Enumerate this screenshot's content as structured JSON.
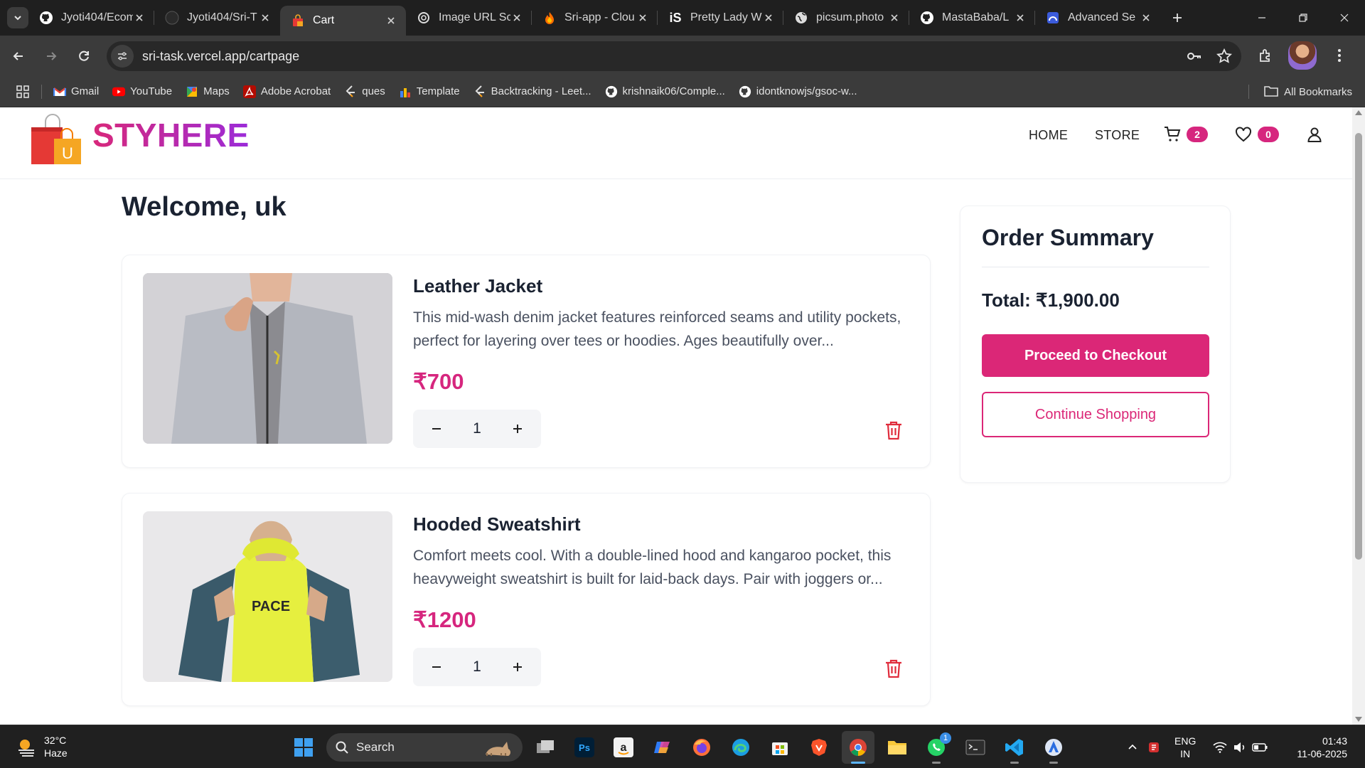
{
  "browser": {
    "tabs": [
      {
        "title": "Jyoti404/Ecom",
        "icon": "github-icon"
      },
      {
        "title": "Jyoti404/Sri-T",
        "icon": "github-icon"
      },
      {
        "title": "Cart",
        "icon": "shopping-bag-icon",
        "active": true
      },
      {
        "title": "Image URL Sc",
        "icon": "openai-icon"
      },
      {
        "title": "Sri-app - Clou",
        "icon": "firebase-icon"
      },
      {
        "title": "Pretty Lady W",
        "icon": "istock-icon"
      },
      {
        "title": "picsum.photo",
        "icon": "globe-icon"
      },
      {
        "title": "MastaBaba/L",
        "icon": "github-icon"
      },
      {
        "title": "Advanced Se",
        "icon": "search-console-icon"
      }
    ],
    "url": "sri-task.vercel.app/cartpage",
    "bookmarks": [
      {
        "label": "Gmail",
        "icon": "gmail-icon"
      },
      {
        "label": "YouTube",
        "icon": "youtube-icon"
      },
      {
        "label": "Maps",
        "icon": "maps-icon"
      },
      {
        "label": "Adobe Acrobat",
        "icon": "acrobat-icon"
      },
      {
        "label": "ques",
        "icon": "leetcode-icon"
      },
      {
        "label": "Template",
        "icon": "chart-icon"
      },
      {
        "label": "Backtracking - Leet...",
        "icon": "leetcode-icon"
      },
      {
        "label": "krishnaik06/Comple...",
        "icon": "github-icon"
      },
      {
        "label": "idontknowjs/gsoc-w...",
        "icon": "github-icon"
      }
    ],
    "all_bookmarks": "All Bookmarks"
  },
  "site": {
    "brand": "STYHERE",
    "nav": {
      "home": "HOME",
      "store": "STORE",
      "cart_count": "2",
      "wishlist_count": "0"
    },
    "welcome": "Welcome, uk",
    "cart_items": [
      {
        "name": "Leather Jacket",
        "description": "This mid-wash denim jacket features reinforced seams and utility pockets, perfect for layering over tees or hoodies. Ages beautifully over...",
        "price": "₹700",
        "quantity": "1"
      },
      {
        "name": "Hooded Sweatshirt",
        "description": "Comfort meets cool. With a double-lined hood and kangaroo pocket, this heavyweight sweatshirt is built for laid-back days. Pair with joggers or...",
        "price": "₹1200",
        "quantity": "1"
      }
    ],
    "summary": {
      "title": "Order Summary",
      "total": "Total: ₹1,900.00",
      "checkout": "Proceed to Checkout",
      "continue": "Continue Shopping"
    },
    "accent_color": "#db2777"
  },
  "taskbar": {
    "weather_temp": "32°C",
    "weather_desc": "Haze",
    "search": "Search",
    "lang_top": "ENG",
    "lang_bottom": "IN",
    "time": "01:43",
    "date": "11-06-2025",
    "whatsapp_badge": "1"
  }
}
